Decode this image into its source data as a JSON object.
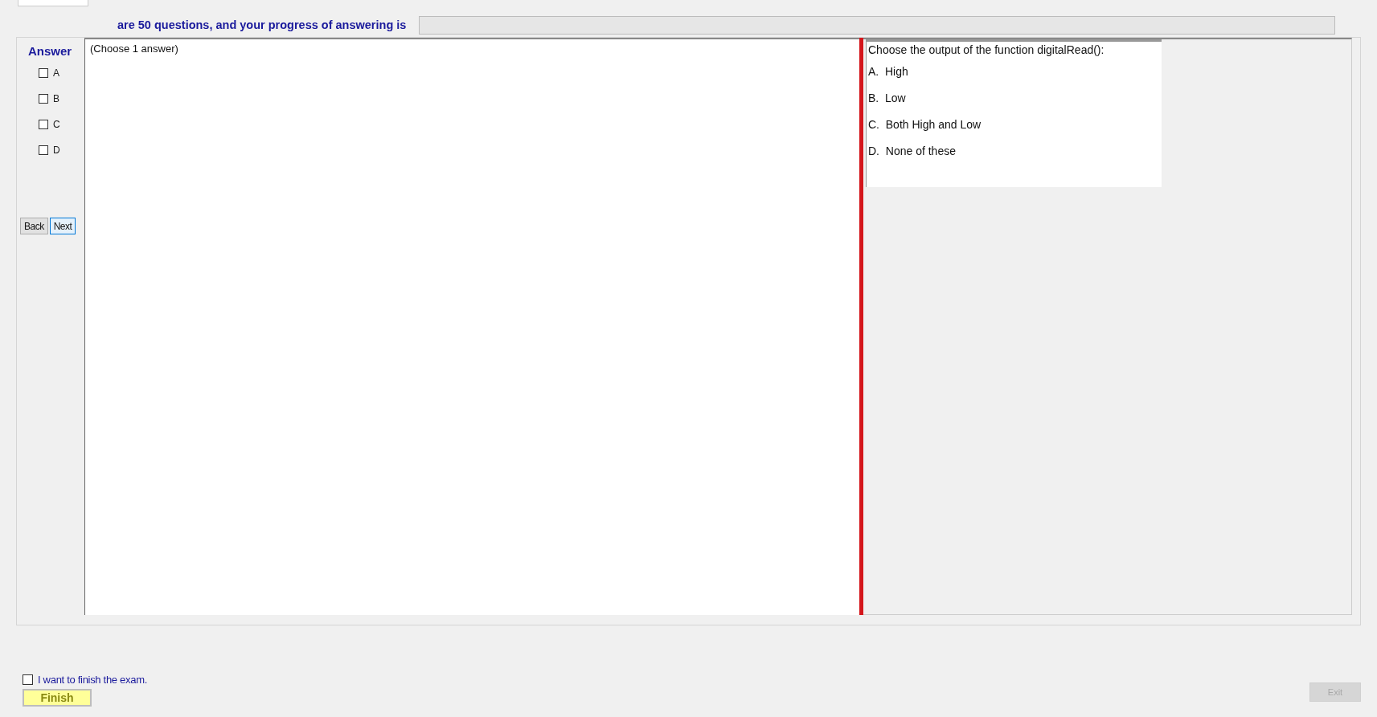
{
  "header": {
    "text": "are 50 questions, and your progress of answering is",
    "progress": {
      "level": 0
    }
  },
  "answer_panel": {
    "title": "Answer",
    "options": [
      {
        "label": "A",
        "checked": false
      },
      {
        "label": "B",
        "checked": false
      },
      {
        "label": "C",
        "checked": false
      },
      {
        "label": "D",
        "checked": false
      }
    ],
    "buttons": [
      {
        "label": "Back",
        "focused": false
      },
      {
        "label": "Next",
        "focused": true
      }
    ]
  },
  "instruction": "(Choose 1 answer)",
  "question": {
    "prompt": "Choose the output of the function digitalRead():",
    "choices": [
      {
        "text": "A.  High"
      },
      {
        "text": "B.  Low"
      },
      {
        "text": "C.  Both High and Low"
      },
      {
        "text": "D.  None of these"
      }
    ]
  },
  "finish": {
    "confirm": {
      "label": "I want to finish the exam.",
      "checked": false
    },
    "button": "Finish"
  },
  "exit": {
    "label": "Exit",
    "disabled": true
  }
}
